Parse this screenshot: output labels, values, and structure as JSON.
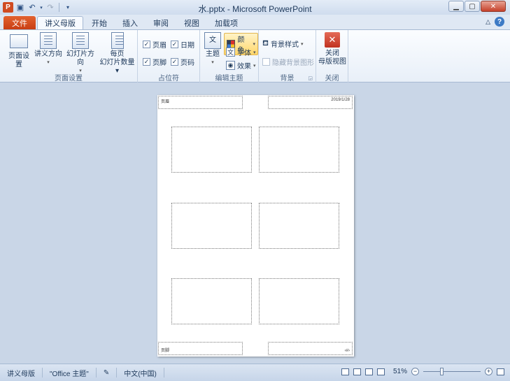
{
  "titlebar": {
    "app_icon": "P",
    "title": "水.pptx - Microsoft PowerPoint",
    "qat": [
      "save-icon",
      "undo-icon",
      "redo-icon",
      "customize-icon"
    ]
  },
  "tabs": {
    "file": "文件",
    "items": [
      "讲义母版",
      "开始",
      "插入",
      "审阅",
      "视图",
      "加载项"
    ],
    "active": "讲义母版"
  },
  "ribbon": {
    "page_setup": {
      "label": "页面设置",
      "page_setup_btn": "页面设置",
      "handout_orientation": "讲义方向",
      "slide_orientation": "幻灯片方向",
      "slides_per_page": "每页",
      "slides_per_page_2": "幻灯片数量"
    },
    "placeholders": {
      "label": "占位符",
      "header": "页眉",
      "date": "日期",
      "footer": "页脚",
      "page_number": "页码"
    },
    "edit_theme": {
      "label": "编辑主题",
      "theme": "主题",
      "colors": "颜色",
      "fonts": "字体",
      "effects": "效果"
    },
    "background": {
      "label": "背景",
      "background_styles": "背景样式",
      "hide_background": "隐藏背景图形"
    },
    "close": {
      "label": "关闭",
      "close_master": "关闭",
      "close_master_2": "母版视图"
    }
  },
  "page": {
    "header_text": "页眉",
    "date_text": "2019/1/28",
    "footer_text": "页脚",
    "page_number_text": "‹#›"
  },
  "statusbar": {
    "view": "讲义母版",
    "theme": "\"Office 主题\"",
    "language": "中文(中国)",
    "zoom": "51%"
  }
}
